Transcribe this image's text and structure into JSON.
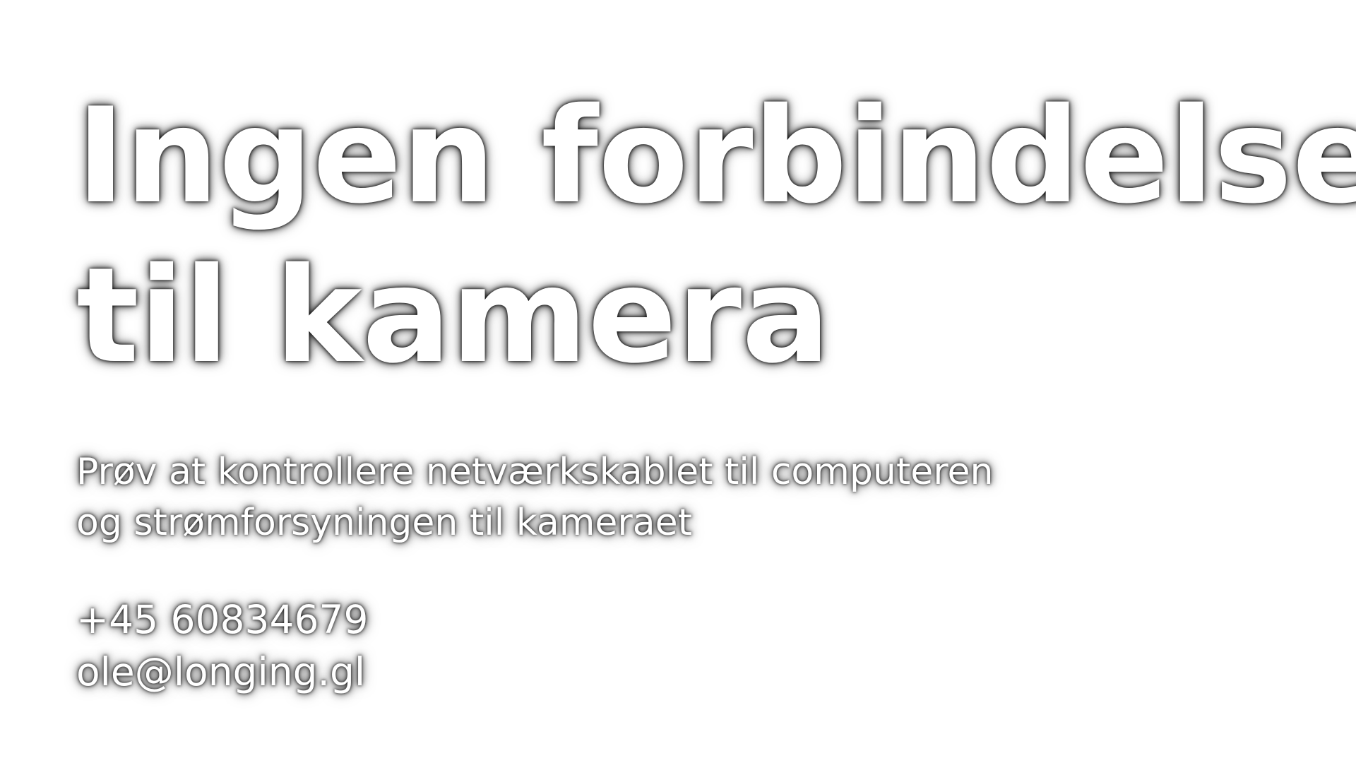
{
  "screen": {
    "background_color": "#ffffff",
    "text_color": "#ffffff",
    "shadow_color": "#000000"
  },
  "error": {
    "title_line1": "Ingen forbindelse",
    "title_line2": "til kamera",
    "message_line1": "Prøv at kontrollere netværkskablet til computeren",
    "message_line2": "og strømforsyningen til kameraet"
  },
  "contact": {
    "phone": "+45 60834679",
    "email": "ole@longing.gl"
  }
}
